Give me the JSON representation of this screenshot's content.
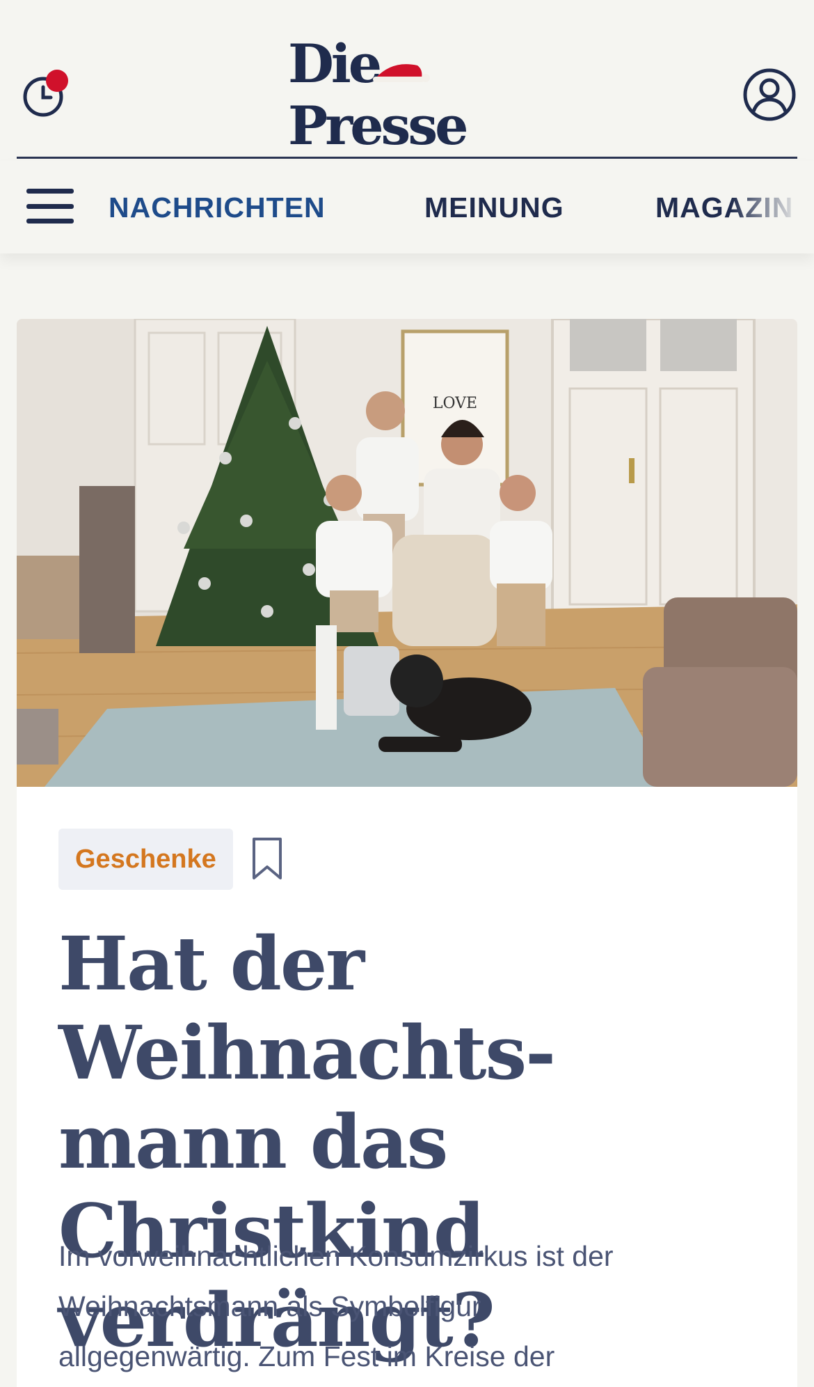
{
  "header": {
    "logo_text": "Die Presse",
    "clock_icon": "clock-icon",
    "user_icon": "user-icon"
  },
  "nav": {
    "menu_icon": "hamburger-menu-icon",
    "items": [
      {
        "label": "NACHRICHTEN",
        "active": true
      },
      {
        "label": "MEINUNG",
        "active": false
      },
      {
        "label": "MAGAZIN",
        "active": false
      }
    ]
  },
  "article": {
    "tag": "Geschenke",
    "bookmark_icon": "bookmark-icon",
    "headline": "Hat der Weihnachts-\nmann das Christkind\nverdrängt?",
    "lead": "Im vorweihnachtlichen Konsumzirkus ist der\nWeihnachtsmann als Symbolfigur\nallgegenwärtig. Zum Fest im Kreise der",
    "poster_text": "LOVE"
  },
  "colors": {
    "background": "#f5f5f1",
    "brand_navy": "#1f2b4d",
    "active_nav": "#1e4b8a",
    "tag_text": "#d4771f",
    "notification_dot": "#d0112b",
    "headline": "#3e4968"
  }
}
